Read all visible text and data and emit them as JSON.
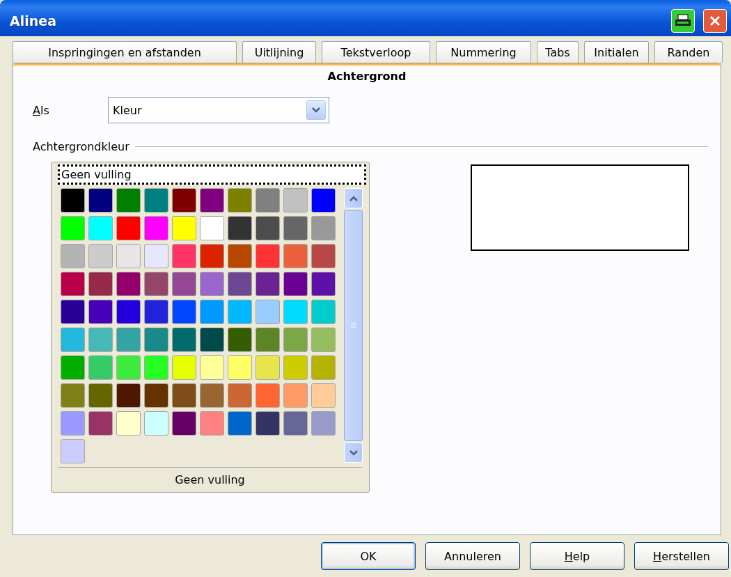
{
  "window": {
    "title": "Alinea"
  },
  "tabs": [
    {
      "label": "Inspringingen en afstanden",
      "selected": false
    },
    {
      "label": "Uitlijning",
      "selected": false
    },
    {
      "label": "Tekstverloop",
      "selected": false
    },
    {
      "label": "Nummering",
      "selected": false
    },
    {
      "label": "Tabs",
      "selected": false
    },
    {
      "label": "Initialen",
      "selected": false
    },
    {
      "label": "Randen",
      "selected": false
    },
    {
      "label": "Achtergrond",
      "selected": true
    }
  ],
  "as_field": {
    "label": "Als",
    "underline_first": true,
    "value": "Kleur"
  },
  "background_color": {
    "heading": "Achtergrondkleur",
    "top_item": {
      "label": "Geen vulling",
      "focused": true
    },
    "swatches": [
      {
        "color": "#000000"
      },
      {
        "color": "#000080"
      },
      {
        "color": "#008000"
      },
      {
        "color": "#008080"
      },
      {
        "color": "#800000"
      },
      {
        "color": "#800080"
      },
      {
        "color": "#808000"
      },
      {
        "color": "#808080"
      },
      {
        "color": "#c0c0c0"
      },
      {
        "color": "#0000ff"
      },
      {
        "color": "#00ff00"
      },
      {
        "color": "#00ffff"
      },
      {
        "color": "#ff0000"
      },
      {
        "color": "#ff00ff"
      },
      {
        "color": "#ffff00"
      },
      {
        "color": "#ffffff"
      },
      {
        "color": "#333333"
      },
      {
        "color": "#4d4d4d"
      },
      {
        "color": "#666666"
      },
      {
        "color": "#999999"
      },
      {
        "color": "#b3b3b3"
      },
      {
        "color": "#cccccc"
      },
      {
        "color": "#e6e6e6"
      },
      {
        "color": "#e6e6ff"
      },
      {
        "color": "#ff3366"
      },
      {
        "color": "#dc2300"
      },
      {
        "color": "#b84700"
      },
      {
        "color": "#ff3333"
      },
      {
        "color": "#eb613d"
      },
      {
        "color": "#b84747"
      },
      {
        "color": "#b8004a"
      },
      {
        "color": "#99284d"
      },
      {
        "color": "#94006b"
      },
      {
        "color": "#94476b"
      },
      {
        "color": "#944794"
      },
      {
        "color": "#9966cc"
      },
      {
        "color": "#6b4794"
      },
      {
        "color": "#6b2394"
      },
      {
        "color": "#6b0094"
      },
      {
        "color": "#5e11a6"
      },
      {
        "color": "#280099"
      },
      {
        "color": "#4700b8"
      },
      {
        "color": "#2300dc"
      },
      {
        "color": "#2323dc"
      },
      {
        "color": "#0047ff"
      },
      {
        "color": "#0099ff"
      },
      {
        "color": "#00b8ff"
      },
      {
        "color": "#99ccff"
      },
      {
        "color": "#00dcff"
      },
      {
        "color": "#00cccc"
      },
      {
        "color": "#23b8dc"
      },
      {
        "color": "#47b8b8"
      },
      {
        "color": "#33a3a3"
      },
      {
        "color": "#198a8a"
      },
      {
        "color": "#006b6b"
      },
      {
        "color": "#004a4a"
      },
      {
        "color": "#355e00"
      },
      {
        "color": "#5c8526"
      },
      {
        "color": "#7da647"
      },
      {
        "color": "#94bd5e"
      },
      {
        "color": "#00ae00"
      },
      {
        "color": "#33cc66"
      },
      {
        "color": "#3deb3d"
      },
      {
        "color": "#23ff23"
      },
      {
        "color": "#e6ff00"
      },
      {
        "color": "#ffff99"
      },
      {
        "color": "#ffff66"
      },
      {
        "color": "#e6e64c"
      },
      {
        "color": "#cccc00"
      },
      {
        "color": "#b3b300"
      },
      {
        "color": "#808019"
      },
      {
        "color": "#666600"
      },
      {
        "color": "#4c1900"
      },
      {
        "color": "#663300"
      },
      {
        "color": "#804c19"
      },
      {
        "color": "#996633"
      },
      {
        "color": "#cc6633"
      },
      {
        "color": "#ff6633"
      },
      {
        "color": "#ff9966"
      },
      {
        "color": "#ffcc99"
      },
      {
        "color": "#9999ff"
      },
      {
        "color": "#993366"
      },
      {
        "color": "#ffffcc"
      },
      {
        "color": "#ccffff"
      },
      {
        "color": "#660066"
      },
      {
        "color": "#ff8080"
      },
      {
        "color": "#0066cc"
      },
      {
        "color": "#333366"
      },
      {
        "color": "#666699"
      },
      {
        "color": "#9999cc"
      },
      {
        "color": "#ccccff"
      }
    ],
    "selected_name": "Geen vulling"
  },
  "buttons": [
    {
      "label": "OK",
      "default": true
    },
    {
      "label": "Annuleren",
      "default": false
    },
    {
      "label": "Help",
      "default": false,
      "underline_first": true
    },
    {
      "label": "Herstellen",
      "default": false,
      "underline_first": true
    }
  ]
}
